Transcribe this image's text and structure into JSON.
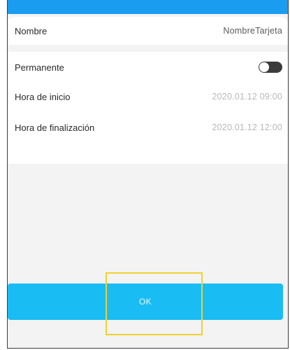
{
  "form": {
    "name": {
      "label": "Nombre",
      "value": "NombreTarjeta"
    },
    "permanent": {
      "label": "Permanente",
      "enabled": false
    },
    "start": {
      "label": "Hora de inicio",
      "value": "2020.01.12 09:00"
    },
    "end": {
      "label": "Hora de finalización",
      "value": "2020.01.12 12:00"
    }
  },
  "ok_button": {
    "label": "OK"
  },
  "colors": {
    "accent": "#19bdf4",
    "header": "#1a9df0",
    "highlight": "#f0d030"
  }
}
